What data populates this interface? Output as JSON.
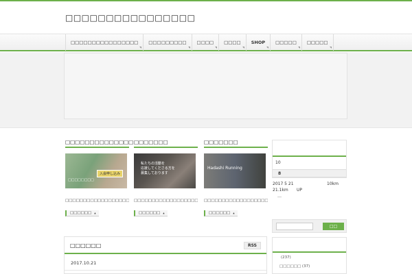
{
  "site": {
    "title": "□□□□□□□□□□□□□□□□"
  },
  "nav": {
    "items": [
      {
        "label": "□□□□□□□□□□□□□□□□",
        "bold": false
      },
      {
        "label": "□□□□□□□□□",
        "bold": false
      },
      {
        "label": "□□□□",
        "bold": false
      },
      {
        "label": "□□□□",
        "bold": false
      },
      {
        "label": "SHOP",
        "bold": true
      },
      {
        "label": "□□□□□",
        "bold": false
      },
      {
        "label": "□□□□□",
        "bold": false
      }
    ]
  },
  "columns": [
    {
      "title": "□□□□□□□□□□□□□□",
      "image_caption": "□□□□□□□□",
      "image_badge": "入会申し込み",
      "text": "□□□□□□□□□□□□□□□□□□□□□□□□□□□□□□□□□□□□□□",
      "more": "□□□□□□"
    },
    {
      "title": "□□□□□□□",
      "image_caption": "私たちの活動を\n応援してくださる方を\n募集しております",
      "image_badge": "",
      "text": "□□□□□□□□□□□□□□□□□□□□□□□□□□□□□□□□□□□",
      "more": "□□□□□□"
    },
    {
      "title": "□□□□□□□",
      "image_caption": "Hadashi Running",
      "image_badge": "",
      "text": "□□□□□□□□□□□□□□□□□□□□",
      "more": "□□□□□□"
    }
  ],
  "sidebar": {
    "calendar_row1": "10",
    "calendar_row2": "8",
    "info_date": "2017 5 21",
    "info_dist": "10km",
    "info_total": "21.1km",
    "info_up": "UP",
    "info_extra": "…",
    "search_button": "□□",
    "archive_count": "(237)",
    "archive_item": "□□□□□□ (37)"
  },
  "news": {
    "title": "□□□□□□",
    "rss_label": "RSS",
    "date": "2017.10.21"
  },
  "colors": {
    "accent": "#6cb04a",
    "nav_bg": "#f3f3f3",
    "band_bg": "#f2f2f2"
  }
}
